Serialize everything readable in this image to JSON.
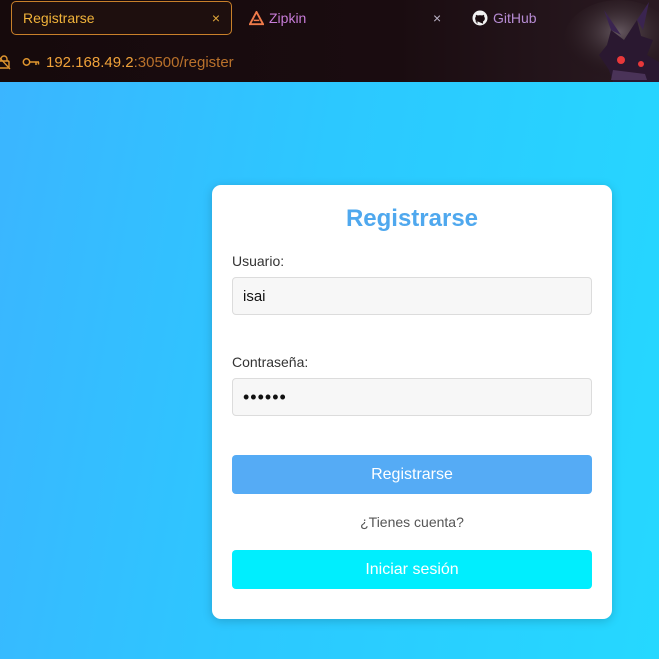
{
  "browser": {
    "tabs": [
      {
        "label": "Registrarse",
        "close": "×",
        "active": true
      },
      {
        "label": "Zipkin",
        "icon": "zipkin-icon",
        "close": "×"
      },
      {
        "label": "GitHub",
        "icon": "github-icon"
      }
    ],
    "url": {
      "host": "192.168.49.2",
      "rest": ":30500/register"
    }
  },
  "page": {
    "title": "Registrarse",
    "username": {
      "label": "Usuario:",
      "value": "isai"
    },
    "password": {
      "label": "Contraseña:",
      "value": "••••••"
    },
    "register_button": "Registrarse",
    "question": "¿Tienes cuenta?",
    "login_button": "Iniciar sesión"
  },
  "colors": {
    "background": "#2ec6ff",
    "title": "#4fa8ee",
    "primary_button": "#55abf5",
    "secondary_button": "#00eefe",
    "active_tab": "#f1b33a"
  }
}
